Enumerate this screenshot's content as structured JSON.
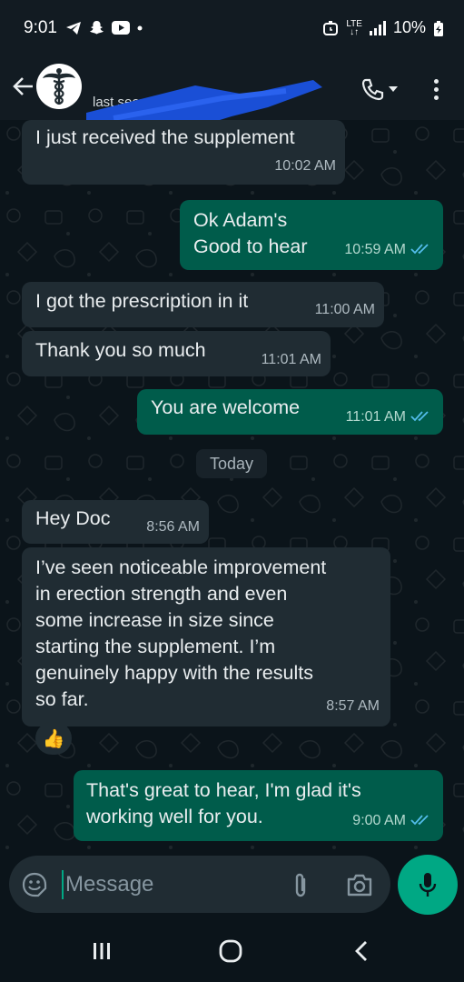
{
  "status_bar": {
    "time": "9:01",
    "battery": "10%",
    "network": "LTE",
    "icons": [
      "telegram-icon",
      "snapchat-icon",
      "youtube-icon",
      "dot-icon",
      "alarm-icon",
      "signal-icon",
      "battery-charging-icon"
    ]
  },
  "header": {
    "last_seen": "last seen today at 8:58 AM",
    "icons": [
      "back-arrow-icon",
      "caduceus-avatar",
      "phone-icon",
      "chevron-down-icon",
      "more-vert-icon"
    ]
  },
  "messages": [
    {
      "direction": "in",
      "text": "I just received the supplement",
      "time": "10:02 AM"
    },
    {
      "direction": "out",
      "text": [
        "Ok Adam's",
        "Good to hear"
      ],
      "time": "10:59 AM",
      "read": true
    },
    {
      "direction": "in",
      "text": "I got the prescription in it",
      "time": "11:00 AM"
    },
    {
      "direction": "in",
      "text": "Thank you so much",
      "time": "11:01 AM"
    },
    {
      "direction": "out",
      "text": "You are welcome",
      "time": "11:01 AM",
      "read": true
    },
    {
      "direction": "in",
      "text": "Hey Doc",
      "time": "8:56 AM"
    },
    {
      "direction": "in",
      "text": [
        "I’ve seen noticeable improvement",
        "in erection strength and even",
        "some increase in size since",
        "starting the supplement. I’m",
        "genuinely happy with the results",
        "so far."
      ],
      "time": "8:57 AM",
      "reaction": "👍"
    },
    {
      "direction": "out",
      "text": [
        "That's great to hear, I'm glad it's",
        "working well for you."
      ],
      "time": "9:00 AM",
      "read": true
    }
  ],
  "date_chip": "Today",
  "composer": {
    "placeholder": "Message"
  },
  "colors": {
    "background": "#0b141a",
    "bar": "#121b22",
    "incoming_bubble": "#202c33",
    "outgoing_bubble": "#005c4b",
    "accent": "#00a884",
    "read_ticks": "#53bdeb",
    "redaction": "#1a4fd6"
  },
  "nav_icons": [
    "recent-apps-icon",
    "home-icon",
    "back-icon"
  ]
}
